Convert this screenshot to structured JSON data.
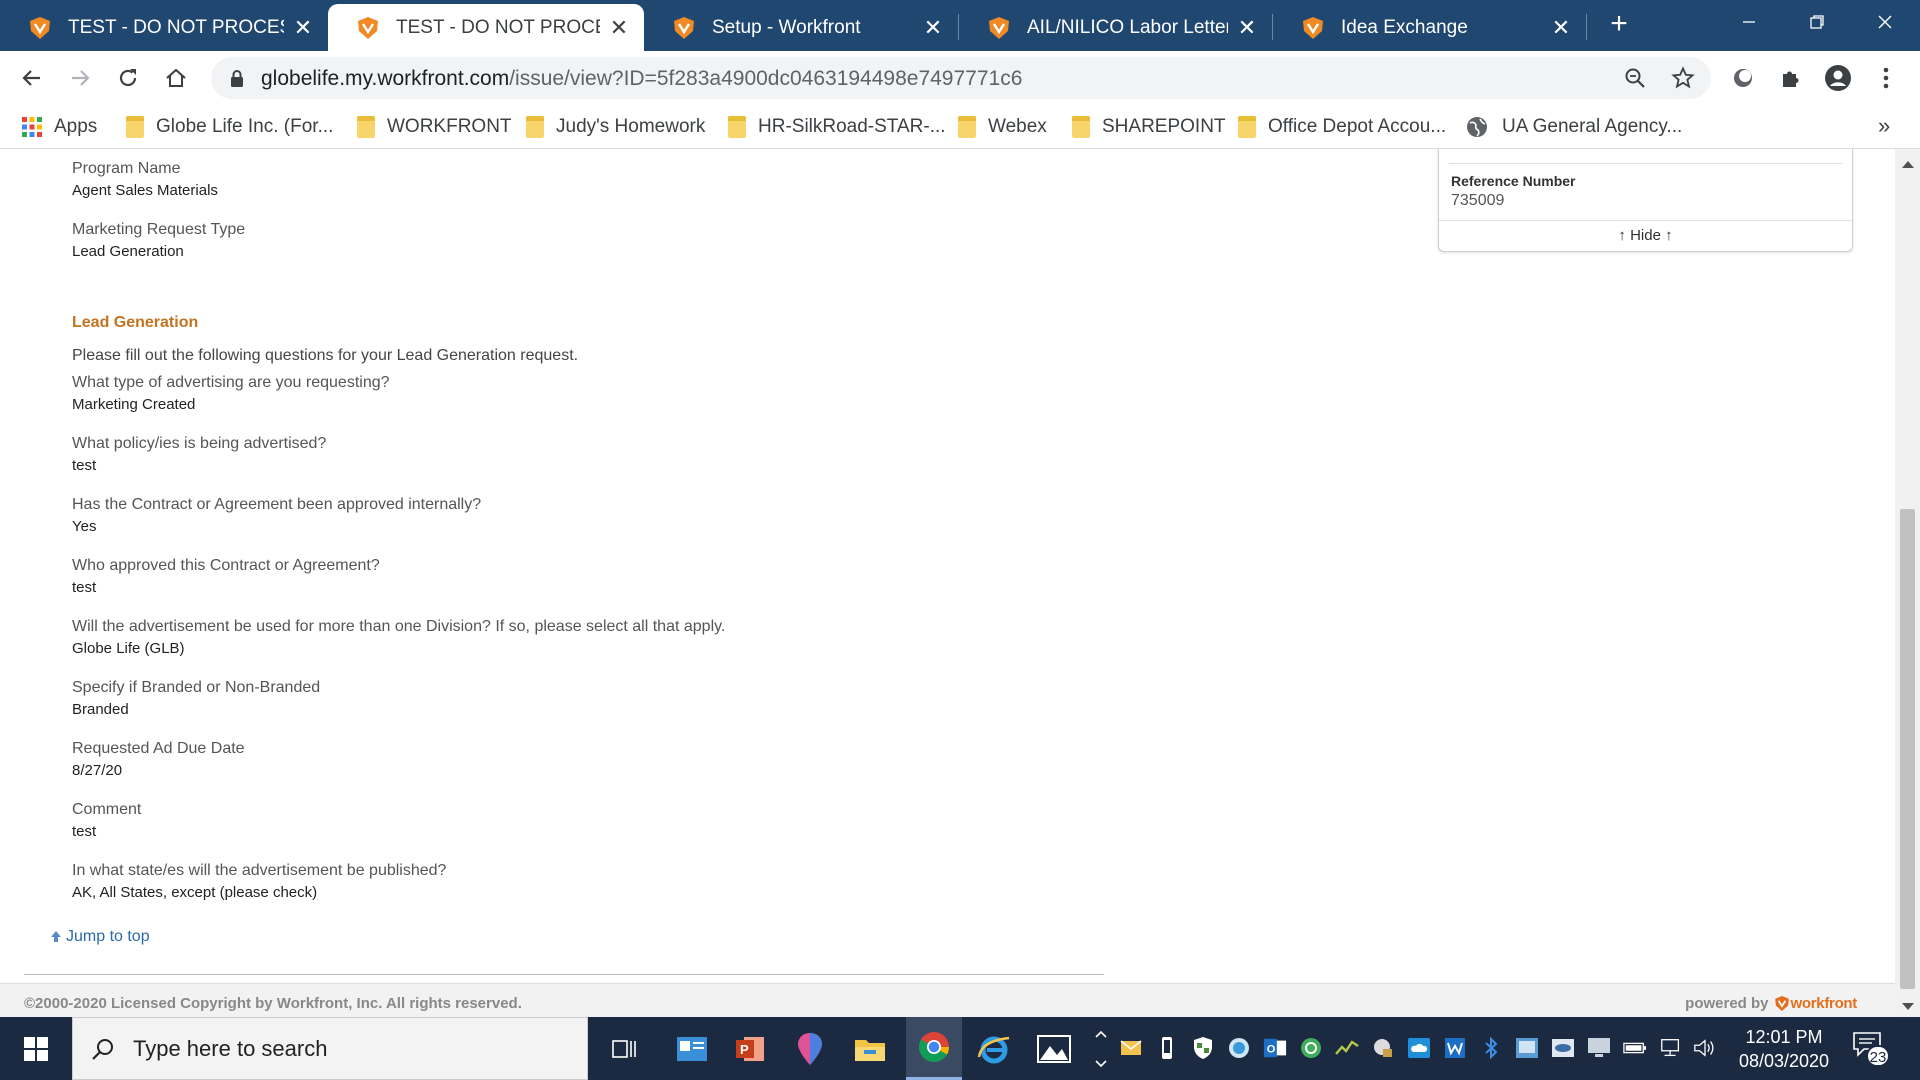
{
  "browser": {
    "tabs": [
      {
        "title": "TEST - DO NOT PROCESS",
        "active": false
      },
      {
        "title": "TEST - DO NOT PROCESS",
        "active": true
      },
      {
        "title": "Setup - Workfront",
        "active": false
      },
      {
        "title": "AIL/NILICO Labor Letter Ne",
        "active": false
      },
      {
        "title": "Idea Exchange",
        "active": false
      }
    ],
    "close_glyph": "✕",
    "new_tab_glyph": "+",
    "url_host": "globelife.my.workfront.com",
    "url_path": "/issue/view?ID=5f283a4900dc0463194498e7497771c6",
    "bookmarks": [
      {
        "label": "Apps",
        "icon": "apps-grid-icon"
      },
      {
        "label": "Globe Life Inc. (For...",
        "icon": "folder-icon"
      },
      {
        "label": "WORKFRONT",
        "icon": "folder-icon"
      },
      {
        "label": "Judy's Homework",
        "icon": "folder-icon"
      },
      {
        "label": "HR-SilkRoad-STAR-...",
        "icon": "folder-icon"
      },
      {
        "label": "Webex",
        "icon": "folder-icon"
      },
      {
        "label": "SHAREPOINT",
        "icon": "folder-icon"
      },
      {
        "label": "Office Depot Accou...",
        "icon": "folder-icon"
      },
      {
        "label": "UA General Agency...",
        "icon": "globe-icon"
      }
    ],
    "bookmarks_more": "»",
    "colors": {
      "tabstrip": "#1f4770",
      "favicon": "#f08a24"
    }
  },
  "page": {
    "fields_top": [
      {
        "label": "Program Name",
        "value": "Agent Sales Materials"
      },
      {
        "label": "Marketing Request Type",
        "value": "Lead Generation"
      }
    ],
    "section_title": "Lead Generation",
    "section_intro": "Please fill out the following questions for your Lead Generation request.",
    "questions": [
      {
        "label": "What type of advertising are you requesting?",
        "value": "Marketing Created"
      },
      {
        "label": "What policy/ies is being advertised?",
        "value": "test"
      },
      {
        "label": "Has the Contract or Agreement been approved internally?",
        "value": "Yes"
      },
      {
        "label": "Who approved this Contract or Agreement?",
        "value": "test"
      },
      {
        "label": "Will the advertisement be used for more than one Division? If so, please select all that apply.",
        "value": "Globe Life (GLB)"
      },
      {
        "label": "Specify if Branded or Non-Branded",
        "value": "Branded"
      },
      {
        "label": "Requested Ad Due Date",
        "value": "8/27/20"
      },
      {
        "label": "Comment",
        "value": "test"
      },
      {
        "label": "In what state/es will the advertisement be published?",
        "value": "AK, All States, except (please check)"
      }
    ],
    "reference_panel": {
      "label": "Reference Number",
      "value": "735009",
      "hide_label": "↑ Hide ↑"
    },
    "jump_to_top": "Jump to top",
    "footer_copyright": "©2000-2020 Licensed Copyright by Workfront, Inc. All rights reserved.",
    "footer_powered": "powered by",
    "footer_brand": "workfront",
    "colors": {
      "section_title": "#c3741f",
      "link": "#2b6aa8",
      "brand": "#e36f1e"
    }
  },
  "taskbar": {
    "search_placeholder": "Type here to search",
    "time": "12:01 PM",
    "date": "08/03/2020",
    "notification_count": "23"
  }
}
